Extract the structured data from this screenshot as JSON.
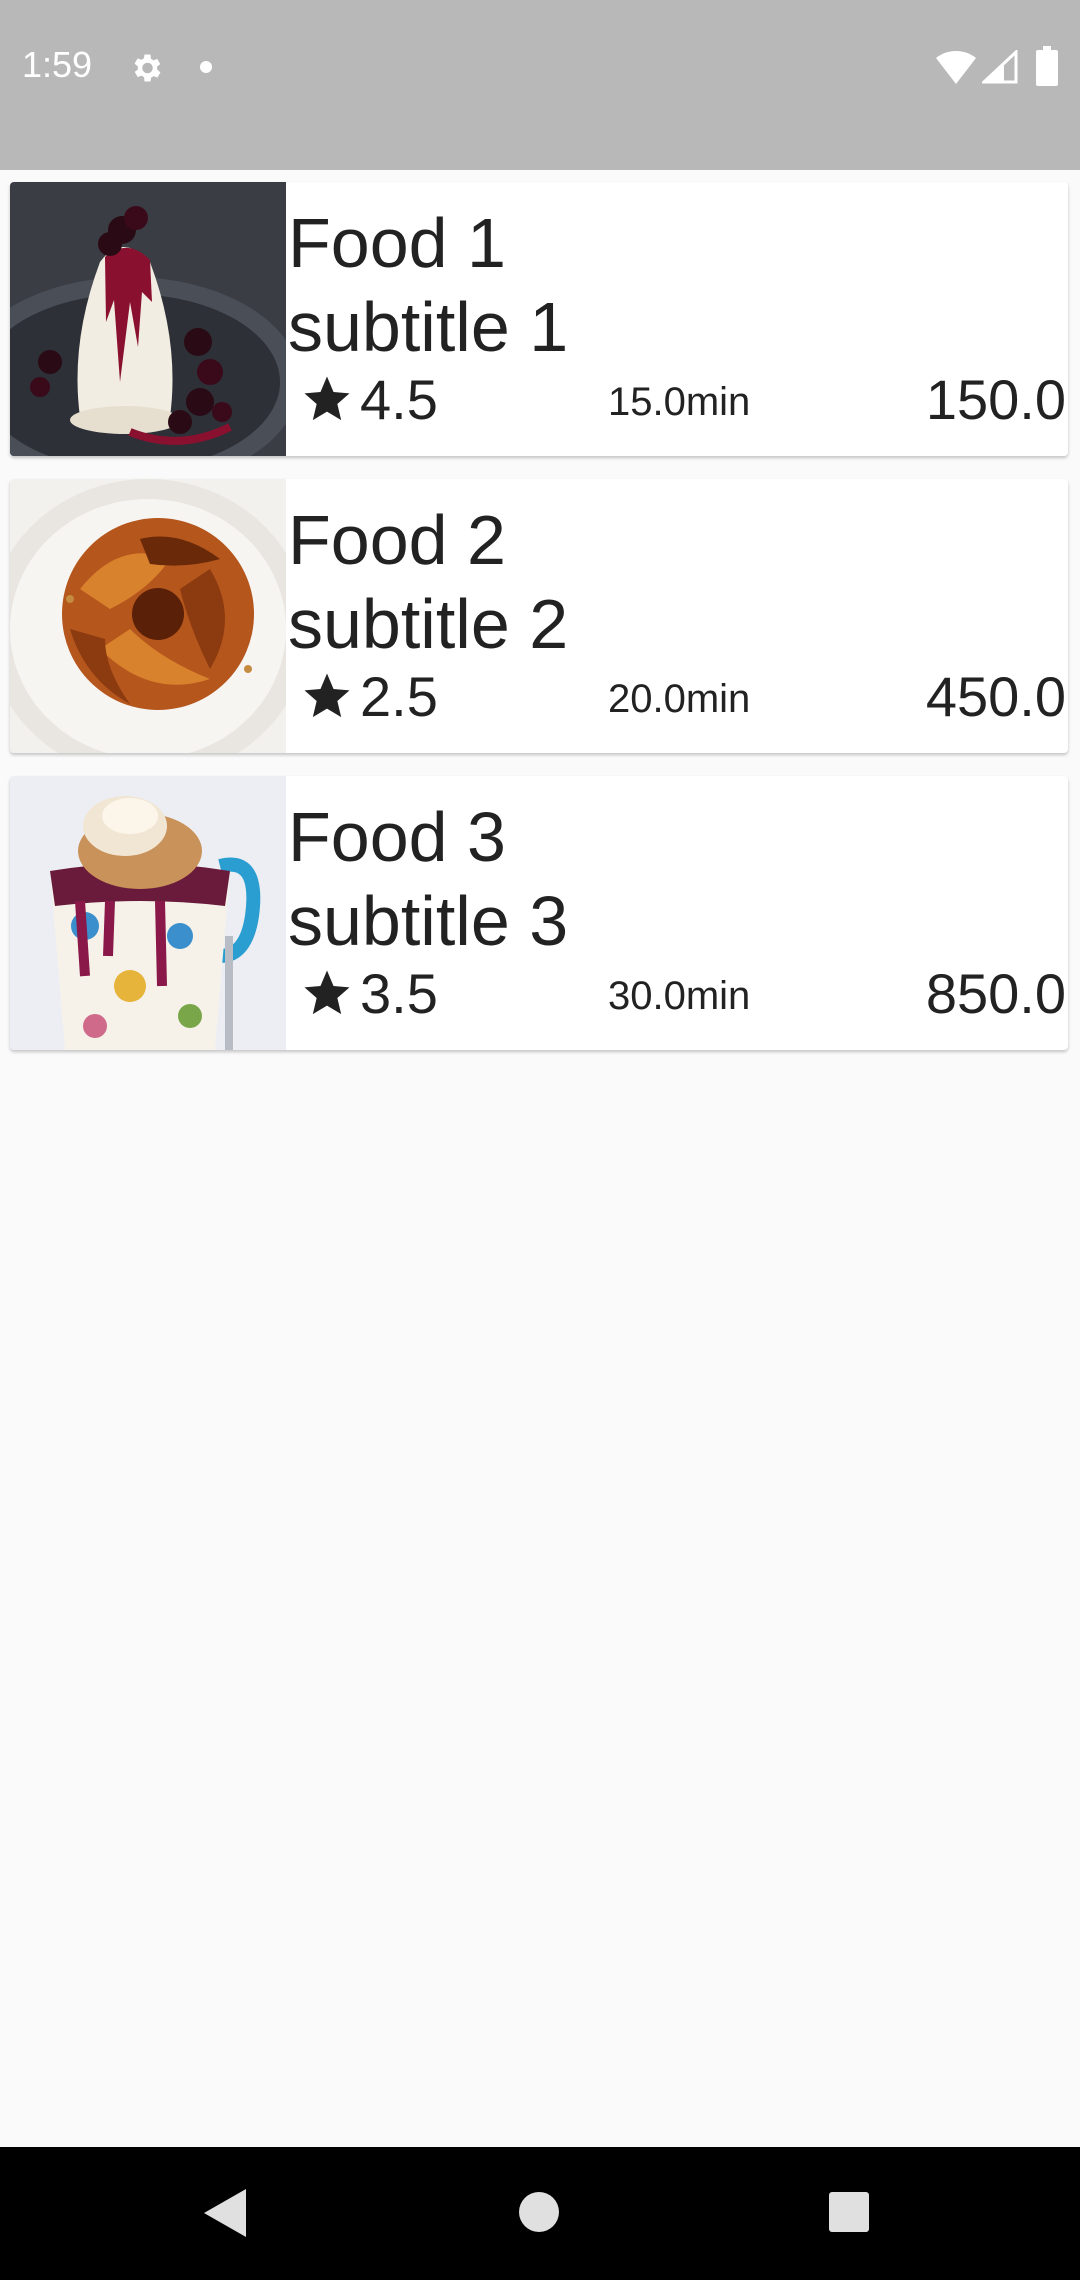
{
  "status_bar": {
    "time": "1:59",
    "icons": [
      "gear-icon",
      "notification-dot-icon",
      "wifi-icon",
      "signal-icon",
      "battery-icon"
    ],
    "background": "#b8b8b8"
  },
  "foods": [
    {
      "title": "Food 1",
      "subtitle": "subtitle 1",
      "rating": "4.5",
      "time": "15.0min",
      "price": "150.0",
      "image": "panna-cotta-with-cherries"
    },
    {
      "title": "Food 2",
      "subtitle": "subtitle 2",
      "rating": "2.5",
      "time": "20.0min",
      "price": "450.0",
      "image": "cinnamon-bun-wreath"
    },
    {
      "title": "Food 3",
      "subtitle": "subtitle 3",
      "rating": "3.5",
      "time": "30.0min",
      "price": "850.0",
      "image": "berry-crumble-in-mug"
    }
  ],
  "nav_bar": {
    "icons": [
      "back-icon",
      "home-icon",
      "recents-icon"
    ],
    "background": "#000000"
  }
}
